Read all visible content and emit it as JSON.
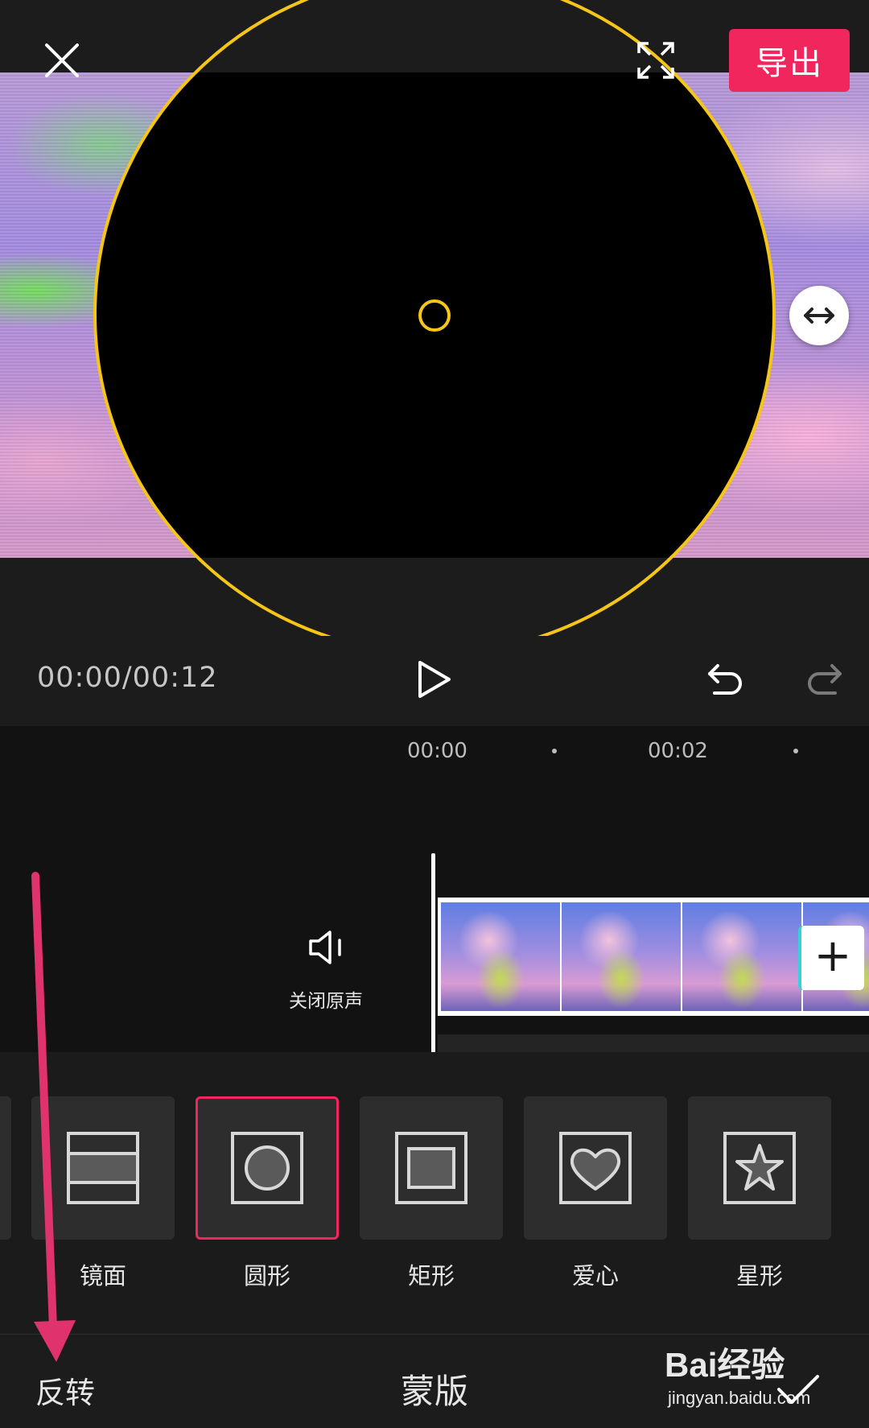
{
  "header": {
    "export_label": "导出"
  },
  "playback": {
    "time": "00:00/00:12"
  },
  "timeline": {
    "ruler_labels": [
      "00:00",
      "00:02"
    ],
    "mute_label": "关闭原声",
    "add_clip_label": "+"
  },
  "mask_options": [
    {
      "label": "镜面",
      "icon": "mirror-mask-icon",
      "selected": false
    },
    {
      "label": "圆形",
      "icon": "circle-mask-icon",
      "selected": true
    },
    {
      "label": "矩形",
      "icon": "rectangle-mask-icon",
      "selected": false
    },
    {
      "label": "爱心",
      "icon": "heart-mask-icon",
      "selected": false
    },
    {
      "label": "星形",
      "icon": "star-mask-icon",
      "selected": false
    }
  ],
  "bottom_bar": {
    "invert_label": "反转",
    "title": "蒙版"
  },
  "watermark": {
    "logo": "Bai经验",
    "url": "jingyan.baidu.com"
  },
  "colors": {
    "accent": "#f0265d",
    "mask_outline": "#f5c518",
    "annotation_arrow": "#e0336e"
  }
}
